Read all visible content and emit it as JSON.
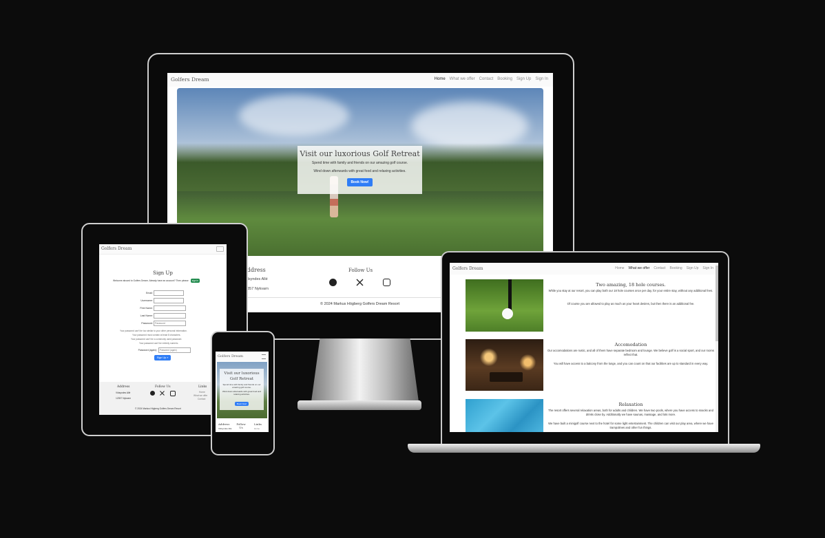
{
  "site": {
    "brand": "Golfers Dream",
    "nav": [
      "Home",
      "What we offer",
      "Contact",
      "Booking",
      "Sign Up",
      "Sign In"
    ]
  },
  "hero": {
    "title": "Visit our luxorious Golf Retreat",
    "line1": "Spend time with family and friends on our amazing golf course.",
    "line2": "Wind down afterwards with great food and relaxing activities.",
    "cta": "Book Now!"
  },
  "footer": {
    "address_title": "Address",
    "street": "Vidsyndes Allé",
    "city": "12357 Nykvarn",
    "follow_title": "Follow Us",
    "links_title": "Links",
    "links": [
      "Home",
      "What we offer",
      "Contact"
    ],
    "copyright": "© 2024 Markus Högberg Golfers Dream Resort"
  },
  "offer": {
    "items": [
      {
        "title": "Two amazing, 18 hole courses.",
        "p1": "While you stay at our resort, you can play both our 18 hole courses once per day, for your entire stay, without any additional fees.",
        "p2": "Of course you are allowed to play as much as your heart desires, but then there is an additional fee."
      },
      {
        "title": "Accomodation",
        "p1": "Our accomodations are rustic, and all of them have separate bedroom and lounge. We believe golf is a social sport, and our rooms reflect that.",
        "p2": "You will have access to a balcony from the lunge, and you can count on that our facilities are up to standard in every way."
      },
      {
        "title": "Relaxation",
        "p1": "The resort offers several relaxation areas, both for adults and children. We have two pools, where you have access to snacks and drinks close by. Additionally we have saunas, massage, and lots more.",
        "p2": "We have built a minigolf course next to the hotel for some light entertainment. The children can visit our play area, where we have trampolines and other fun things."
      }
    ]
  },
  "signup": {
    "title": "Sign Up",
    "intro": "Welcome aboard to Golfers Dream. Already have an account? Then please",
    "signin_label": "sign in",
    "fields": [
      "Email:",
      "Username:",
      "First Name:",
      "Last Name:",
      "Password:"
    ],
    "password_placeholder": "Password",
    "rules": [
      "Your password can't be too similar to your other personal information.",
      "Your password must contain at least 8 characters.",
      "Your password can't be a commonly used password.",
      "Your password can't be entirely numeric."
    ],
    "password_again_label": "Password (again):",
    "password_again_placeholder": "Password (again)",
    "submit": "Sign Up »"
  },
  "phone": {
    "follow_title": "Follow Us"
  },
  "colors": {
    "primary": "#2f7df6",
    "success": "#1f8a4c",
    "background": "#0c0c0c"
  }
}
